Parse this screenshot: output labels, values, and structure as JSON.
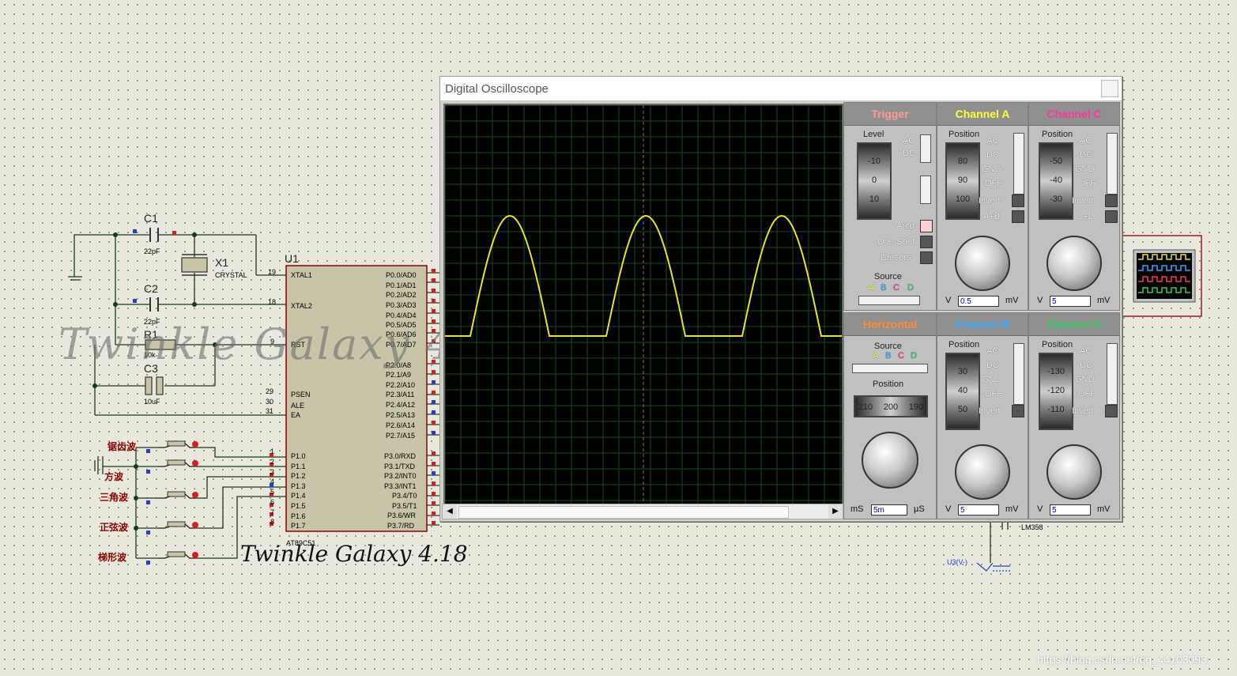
{
  "window": {
    "title": "Digital Oscilloscope"
  },
  "trigger": {
    "title": "Trigger",
    "title_color": "#ff9999",
    "level_label": "Level",
    "drum": [
      "-10",
      "0",
      "10"
    ],
    "ac": "AC",
    "dc": "DC",
    "auto": "Auto",
    "one_shot": "One-Shot",
    "cursors": "Cursors",
    "source_label": "Source",
    "sources": [
      "A",
      "B",
      "C",
      "D"
    ]
  },
  "horizontal": {
    "title": "Horizontal",
    "title_color": "#ff8c33",
    "source_label": "Source",
    "sources": [
      "A",
      "B",
      "C",
      "D"
    ],
    "position_label": "Position",
    "drum": [
      "210",
      "200",
      "190"
    ],
    "value": "5m",
    "unit_left": "mS",
    "unit_right": "µS"
  },
  "channel_a": {
    "title": "Channel A",
    "title_color": "#ffff33",
    "position_label": "Position",
    "drum": [
      "80",
      "90",
      "100"
    ],
    "modes": [
      "AC",
      "DC",
      "GND",
      "OFF"
    ],
    "invert": "Invert",
    "extra": "A+B",
    "value": "0.5",
    "unit_left": "V",
    "unit_right": "mV"
  },
  "channel_b": {
    "title": "Channel B",
    "title_color": "#33aaff",
    "position_label": "Position",
    "drum": [
      "30",
      "40",
      "50"
    ],
    "modes": [
      "AC",
      "DC",
      "GND",
      "OFF"
    ],
    "invert": "Invert",
    "value": "5",
    "unit_left": "V",
    "unit_right": "mV"
  },
  "channel_c": {
    "title": "Channel C",
    "title_color": "#ff3399",
    "position_label": "Position",
    "drum": [
      "-50",
      "-40",
      "-30"
    ],
    "modes": [
      "AC",
      "DC",
      "GND",
      "OFF"
    ],
    "invert": "Invert",
    "extra": "C+D",
    "value": "5",
    "unit_left": "V",
    "unit_right": "mV"
  },
  "channel_d": {
    "title": "Channel D",
    "title_color": "#33cc66",
    "position_label": "Position",
    "drum": [
      "-130",
      "-120",
      "-110"
    ],
    "modes": [
      "AC",
      "DC",
      "GND",
      "OFF"
    ],
    "invert": "Invert",
    "value": "5",
    "unit_left": "V",
    "unit_right": "mV"
  },
  "schematic": {
    "c1": "C1",
    "c1_val": "22pF",
    "c2": "C2",
    "c2_val": "22pF",
    "x1": "X1",
    "x1_val": "CRYSTAL",
    "r1": "R1",
    "r1_val": "10k",
    "c3": "C3",
    "c3_val": "10uF",
    "u1": "U1",
    "u1_part": "AT89C51",
    "lm": "LM358",
    "probe": "U3(V-)",
    "left_pins": [
      {
        "num": "19",
        "name": "XTAL1"
      },
      {
        "num": "18",
        "name": "XTAL2"
      },
      {
        "num": "9",
        "name": "RST"
      },
      {
        "num": "29",
        "name": "PSEN"
      },
      {
        "num": "30",
        "name": "ALE"
      },
      {
        "num": "31",
        "name": "EA"
      },
      {
        "num": "1",
        "name": "P1.0"
      },
      {
        "num": "2",
        "name": "P1.1"
      },
      {
        "num": "3",
        "name": "P1.2"
      },
      {
        "num": "4",
        "name": "P1.3"
      },
      {
        "num": "5",
        "name": "P1.4"
      },
      {
        "num": "6",
        "name": "P1.5"
      },
      {
        "num": "7",
        "name": "P1.6"
      },
      {
        "num": "8",
        "name": "P1.7"
      }
    ],
    "right_pins": [
      "P0.0/AD0",
      "P0.1/AD1",
      "P0.2/AD2",
      "P0.3/AD3",
      "P0.4/AD4",
      "P0.5/AD5",
      "P0.6/AD6",
      "P0.7/AD7",
      "P2.0/A8",
      "P2.1/A9",
      "P2.2/A10",
      "P2.3/A11",
      "P2.4/A12",
      "P2.5/A13",
      "P2.6/A14",
      "P2.7/A15",
      "P3.0/RXD",
      "P3.1/TXD",
      "P3.2/INT0",
      "P3.3/INT1",
      "P3.4/T0",
      "P3.5/T1",
      "P3.6/WR",
      "P3.7/RD"
    ],
    "buttons": [
      "锯齿波",
      "方波",
      "三角波",
      "正弦波",
      "梯形波"
    ],
    "watermark": "Twinkle Galaxy 4.18",
    "signature": "Twinkle Galaxy 4.18"
  },
  "csdn": "https://blog.csdn.net/qq_44103093",
  "waveform": {
    "color": "#e6e61e",
    "shape": "rectified-sine",
    "cycles": 3
  }
}
